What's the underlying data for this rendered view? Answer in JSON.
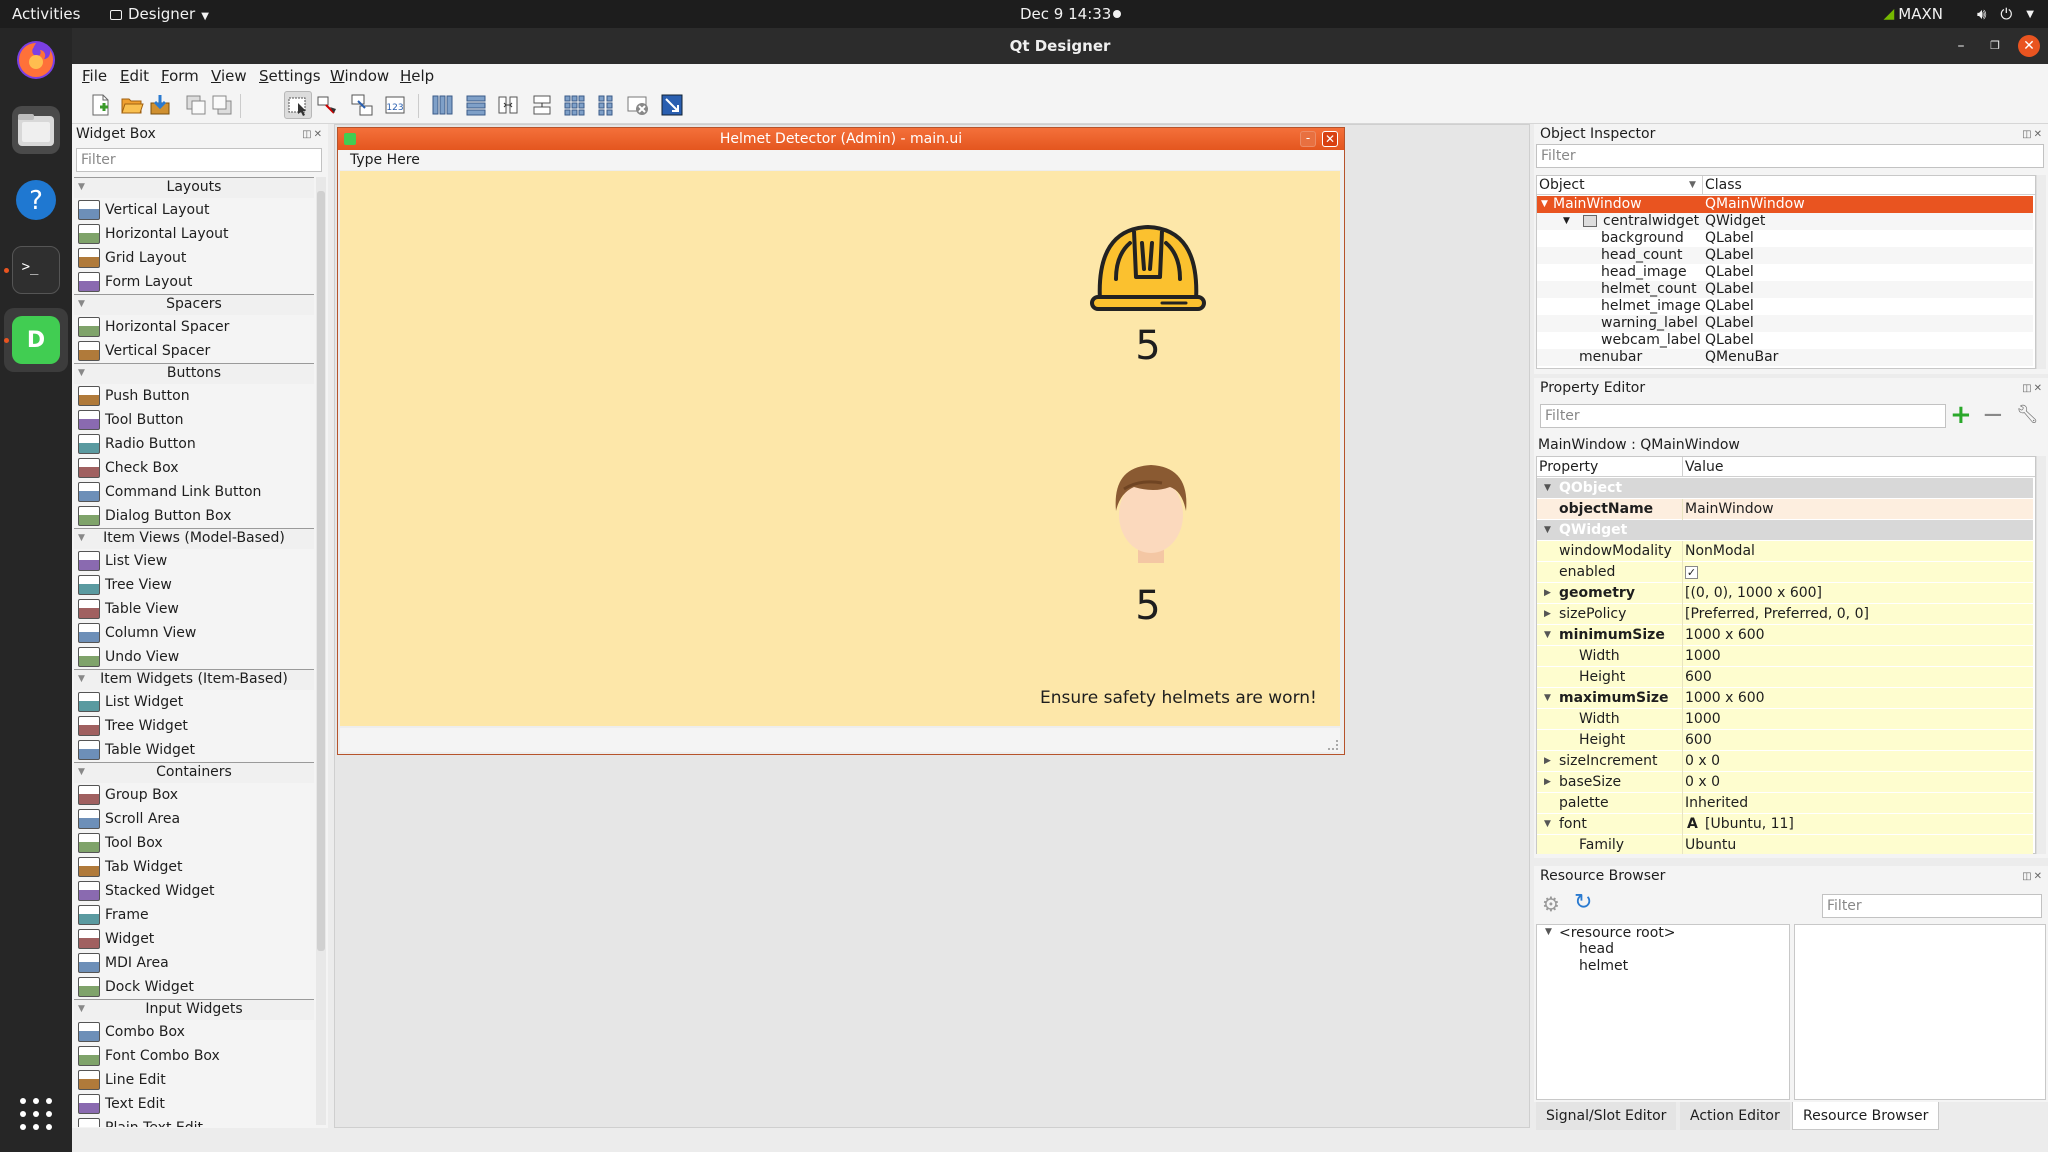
{
  "topbar": {
    "activities": "Activities",
    "app_menu": "Designer",
    "clock": "Dec 9  14:33",
    "nvidia_mode": "MAXN"
  },
  "window": {
    "title": "Qt Designer",
    "menus": [
      "File",
      "Edit",
      "Form",
      "View",
      "Settings",
      "Window",
      "Help"
    ]
  },
  "widget_box": {
    "title": "Widget Box",
    "filter_placeholder": "Filter",
    "categories": [
      {
        "name": "Layouts",
        "items": [
          "Vertical Layout",
          "Horizontal Layout",
          "Grid Layout",
          "Form Layout"
        ]
      },
      {
        "name": "Spacers",
        "items": [
          "Horizontal Spacer",
          "Vertical Spacer"
        ]
      },
      {
        "name": "Buttons",
        "items": [
          "Push Button",
          "Tool Button",
          "Radio Button",
          "Check Box",
          "Command Link Button",
          "Dialog Button Box"
        ]
      },
      {
        "name": "Item Views (Model-Based)",
        "items": [
          "List View",
          "Tree View",
          "Table View",
          "Column View",
          "Undo View"
        ]
      },
      {
        "name": "Item Widgets (Item-Based)",
        "items": [
          "List Widget",
          "Tree Widget",
          "Table Widget"
        ]
      },
      {
        "name": "Containers",
        "items": [
          "Group Box",
          "Scroll Area",
          "Tool Box",
          "Tab Widget",
          "Stacked Widget",
          "Frame",
          "Widget",
          "MDI Area",
          "Dock Widget"
        ]
      },
      {
        "name": "Input Widgets",
        "items": [
          "Combo Box",
          "Font Combo Box",
          "Line Edit",
          "Text Edit",
          "Plain Text Edit"
        ]
      }
    ]
  },
  "form": {
    "title": "Helmet Detector (Admin) - main.ui",
    "menubar_placeholder": "Type Here",
    "helmet_count": "5",
    "head_count": "5",
    "warning": "Ensure safety helmets are worn!",
    "background_color": "#fde7a9"
  },
  "object_inspector": {
    "title": "Object Inspector",
    "filter_placeholder": "Filter",
    "col_object": "Object",
    "col_class": "Class",
    "rows": [
      {
        "object": "MainWindow",
        "class": "QMainWindow"
      },
      {
        "object": "centralwidget",
        "class": "QWidget"
      },
      {
        "object": "background",
        "class": "QLabel"
      },
      {
        "object": "head_count",
        "class": "QLabel"
      },
      {
        "object": "head_image",
        "class": "QLabel"
      },
      {
        "object": "helmet_count",
        "class": "QLabel"
      },
      {
        "object": "helmet_image",
        "class": "QLabel"
      },
      {
        "object": "warning_label",
        "class": "QLabel"
      },
      {
        "object": "webcam_label",
        "class": "QLabel"
      },
      {
        "object": "menubar",
        "class": "QMenuBar"
      }
    ]
  },
  "property_editor": {
    "title": "Property Editor",
    "filter_placeholder": "Filter",
    "context": "MainWindow : QMainWindow",
    "col_property": "Property",
    "col_value": "Value",
    "rows": [
      {
        "name": "QObject",
        "value": ""
      },
      {
        "name": "objectName",
        "value": "MainWindow"
      },
      {
        "name": "QWidget",
        "value": ""
      },
      {
        "name": "windowModality",
        "value": "NonModal"
      },
      {
        "name": "enabled",
        "value": "✓"
      },
      {
        "name": "geometry",
        "value": "[(0, 0), 1000 x 600]"
      },
      {
        "name": "sizePolicy",
        "value": "[Preferred, Preferred, 0, 0]"
      },
      {
        "name": "minimumSize",
        "value": "1000 x 600"
      },
      {
        "name": "Width",
        "value": "1000"
      },
      {
        "name": "Height",
        "value": "600"
      },
      {
        "name": "maximumSize",
        "value": "1000 x 600"
      },
      {
        "name": "Width",
        "value": "1000"
      },
      {
        "name": "Height",
        "value": "600"
      },
      {
        "name": "sizeIncrement",
        "value": "0 x 0"
      },
      {
        "name": "baseSize",
        "value": "0 x 0"
      },
      {
        "name": "palette",
        "value": "Inherited"
      },
      {
        "name": "font",
        "value": "[Ubuntu, 11]"
      },
      {
        "name": "Family",
        "value": "Ubuntu"
      }
    ]
  },
  "resource_browser": {
    "title": "Resource Browser",
    "filter_placeholder": "Filter",
    "root": "<resource root>",
    "children": [
      "head",
      "helmet"
    ]
  },
  "bottom_tabs": [
    "Signal/Slot Editor",
    "Action Editor",
    "Resource Browser"
  ],
  "colors": {
    "accent": "#e95420",
    "selection": "#e95420",
    "prop_highlight": "#fefdcf",
    "prop_group": "#d8d8d8"
  }
}
